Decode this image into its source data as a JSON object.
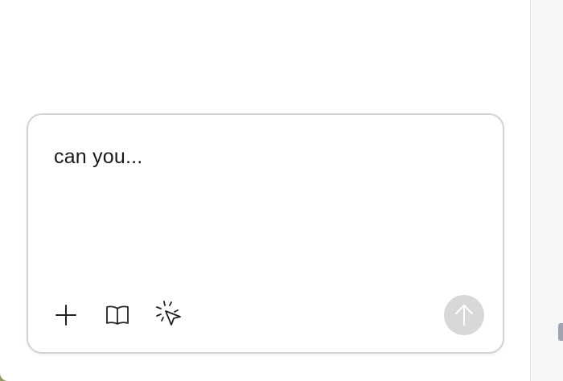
{
  "composer": {
    "text": "can you..."
  },
  "toolbar": {
    "icons": [
      "plus-icon",
      "book-icon",
      "sparkle-pointer-icon"
    ],
    "send_icon": "arrow-up-icon"
  },
  "colors": {
    "composer_border": "#d2d2d2",
    "send_button_bg": "#d8d8d8",
    "side_panel_bg": "#f5f6f8",
    "text": "#1a1a1a"
  }
}
